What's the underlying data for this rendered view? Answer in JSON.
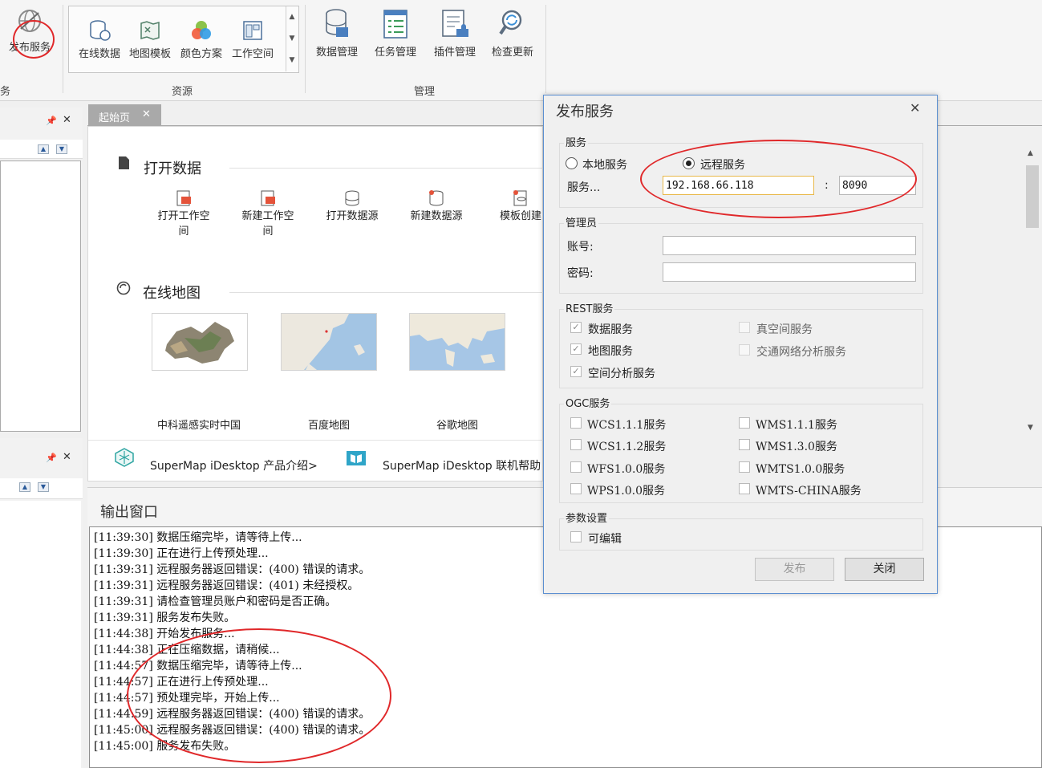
{
  "ribbon": {
    "publish_service": "发布服务",
    "left_group_label_fragment": "务",
    "resources": {
      "label": "资源",
      "items": [
        "在线数据",
        "地图模板",
        "颜色方案",
        "工作空间"
      ]
    },
    "manage": {
      "label": "管理",
      "items": [
        "数据管理",
        "任务管理",
        "插件管理",
        "检查更新"
      ]
    }
  },
  "tabs": {
    "start": "起始页"
  },
  "start_page": {
    "open_data": {
      "title": "打开数据",
      "actions": [
        {
          "line1": "打开工作空",
          "line2": "间"
        },
        {
          "line1": "新建工作空",
          "line2": "间"
        },
        {
          "line1": "打开数据源",
          "line2": ""
        },
        {
          "line1": "新建数据源",
          "line2": ""
        },
        {
          "line1": "模板创建",
          "line2": ""
        }
      ]
    },
    "online_map": {
      "title": "在线地图",
      "maps": [
        "中科遥感实时中国",
        "百度地图",
        "谷歌地图"
      ]
    },
    "links": [
      "SuperMap iDesktop 产品介绍>",
      "SuperMap iDesktop 联机帮助"
    ]
  },
  "output": {
    "title": "输出窗口",
    "lines": [
      "[11:39:30] 数据压缩完毕，请等待上传...",
      "[11:39:30] 正在进行上传预处理...",
      "[11:39:31] 远程服务器返回错误：(400) 错误的请求。",
      "[11:39:31] 远程服务器返回错误：(401) 未经授权。",
      "[11:39:31] 请检查管理员账户和密码是否正确。",
      "[11:39:31] 服务发布失败。",
      "[11:44:38] 开始发布服务...",
      "[11:44:38] 正在压缩数据，请稍候...",
      "[11:44:57] 数据压缩完毕，请等待上传...",
      "[11:44:57] 正在进行上传预处理...",
      "[11:44:57] 预处理完毕，开始上传...",
      "[11:44:59] 远程服务器返回错误：(400) 错误的请求。",
      "[11:45:00] 远程服务器返回错误：(400) 错误的请求。",
      "[11:45:00] 服务发布失败。"
    ]
  },
  "dialog": {
    "title": "发布服务",
    "service_group": "服务",
    "local_service": "本地服务",
    "remote_service": "远程服务",
    "service_label": "服务...",
    "host": "192.168.66.118",
    "colon": ":",
    "port": "8090",
    "admin_group": "管理员",
    "account_label": "账号:",
    "password_label": "密码:",
    "account_value": "",
    "password_value": "",
    "rest_group": "REST服务",
    "rest_items": [
      {
        "label": "数据服务",
        "checked": true
      },
      {
        "label": "地图服务",
        "checked": true
      },
      {
        "label": "空间分析服务",
        "checked": true
      },
      {
        "label": "真空间服务",
        "checked": false
      },
      {
        "label": "交通网络分析服务",
        "checked": false
      }
    ],
    "ogc_group": "OGC服务",
    "ogc_items": [
      "WCS1.1.1服务",
      "WCS1.1.2服务",
      "WFS1.0.0服务",
      "WPS1.0.0服务",
      "WMS1.1.1服务",
      "WMS1.3.0服务",
      "WMTS1.0.0服务",
      "WMTS-CHINA服务"
    ],
    "param_group": "参数设置",
    "editable": "可编辑",
    "publish_button": "发布",
    "close_button": "关闭"
  },
  "colors": {
    "annotation": "#e0282a",
    "dialog_border": "#5b8fd1"
  }
}
